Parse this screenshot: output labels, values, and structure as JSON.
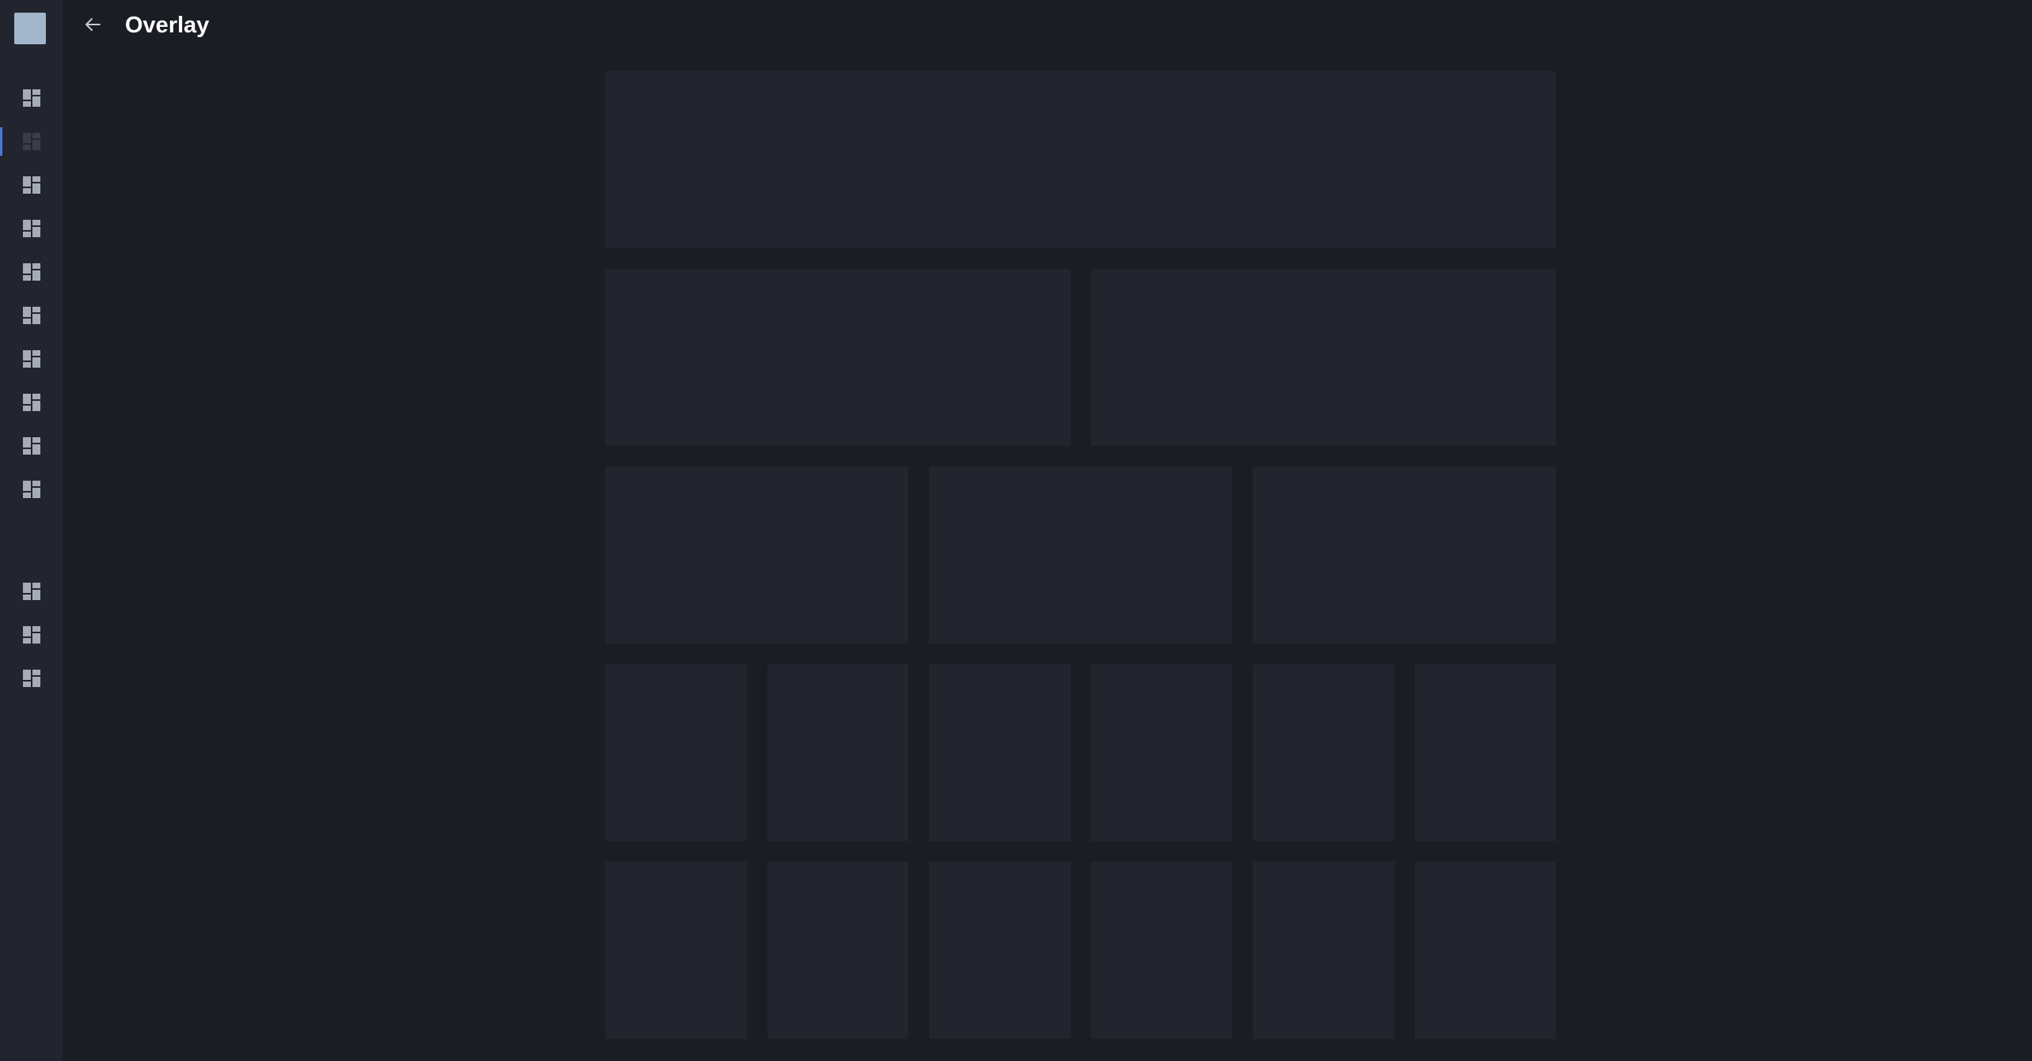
{
  "header": {
    "title": "Overlay",
    "back_icon": "arrow-left-icon"
  },
  "sidebar": {
    "logo": "app-logo",
    "items_icon": "dashboard-icon",
    "active_index": 1,
    "group_one_count": 10,
    "group_two_count": 3
  },
  "colors": {
    "background": "#1b1d25",
    "sidebar": "#22252e",
    "card": "#22252e",
    "logo": "#a3b7cc",
    "accent": "#4a78e0",
    "icon": "#a6abb8",
    "title": "#ffffff"
  },
  "skeleton": {
    "rows": [
      1,
      2,
      3,
      6,
      6
    ]
  }
}
